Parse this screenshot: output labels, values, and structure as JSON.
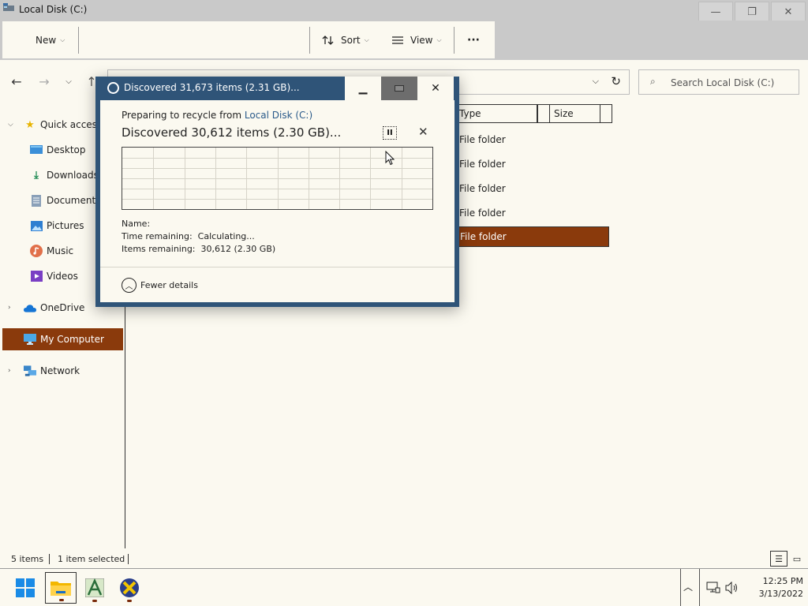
{
  "window": {
    "title": "Local Disk (C:)",
    "controls": {
      "minimize": "—",
      "restore": "❐",
      "close": "✕"
    }
  },
  "toolbar": {
    "new_label": "New",
    "sort_label": "Sort",
    "view_label": "View",
    "more_label": "···"
  },
  "search": {
    "placeholder": "Search Local Disk (C:)"
  },
  "nav": {
    "items": [
      {
        "label": "Quick access",
        "icon": "star-icon"
      },
      {
        "label": "Desktop",
        "icon": "desktop-icon"
      },
      {
        "label": "Downloads",
        "icon": "download-icon"
      },
      {
        "label": "Documents",
        "icon": "document-icon"
      },
      {
        "label": "Pictures",
        "icon": "picture-icon"
      },
      {
        "label": "Music",
        "icon": "music-icon"
      },
      {
        "label": "Videos",
        "icon": "video-icon"
      },
      {
        "label": "OneDrive",
        "icon": "cloud-icon"
      },
      {
        "label": "My Computer",
        "icon": "computer-icon"
      },
      {
        "label": "Network",
        "icon": "network-icon"
      }
    ]
  },
  "columns": {
    "type": "Type",
    "size": "Size"
  },
  "files": [
    {
      "type": "File folder"
    },
    {
      "type": "File folder"
    },
    {
      "type": "File folder"
    },
    {
      "type": "File folder"
    },
    {
      "type": "File folder"
    }
  ],
  "dialog": {
    "title": "Discovered 31,673 items (2.31 GB)...",
    "preparing_prefix": "Preparing to recycle from ",
    "preparing_location": "Local Disk (C:)",
    "discovered": "Discovered 30,612 items (2.30 GB)...",
    "pause_glyph": "II",
    "cancel_glyph": "✕",
    "name_label": "Name:",
    "time_label": "Time remaining:",
    "time_value": "Calculating...",
    "items_label": "Items remaining:",
    "items_value": "30,612 (2.30 GB)",
    "fewer_details": "Fewer details"
  },
  "status": {
    "item_count": "5 items",
    "selected": "1 item selected"
  },
  "taskbar": {
    "time": "12:25 PM",
    "date": "3/13/2022"
  },
  "colors": {
    "selection": "#8a3a0c",
    "dialog_frame": "#2f5478",
    "link": "#2a5a8a"
  }
}
